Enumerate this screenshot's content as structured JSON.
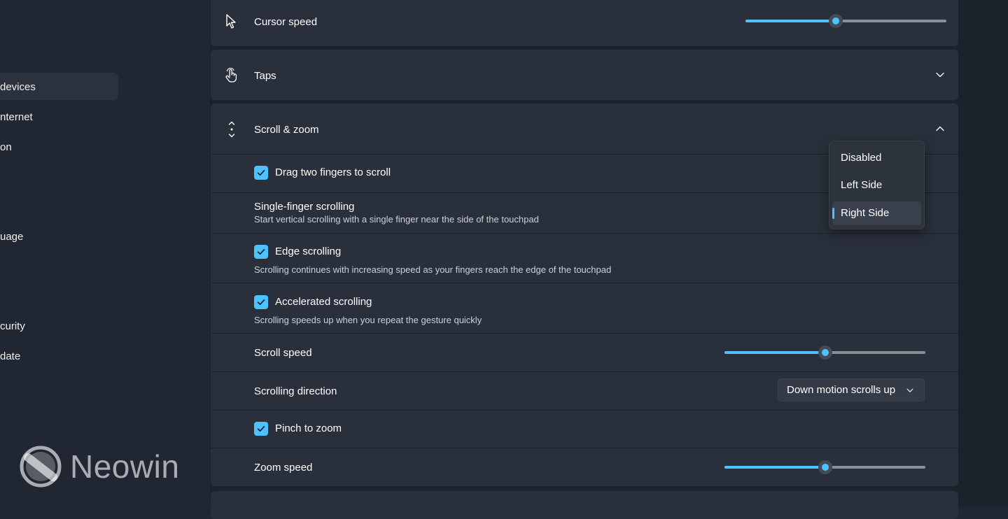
{
  "sidebar": {
    "items": [
      {
        "label": " devices"
      },
      {
        "label": "nternet"
      },
      {
        "label": "on"
      },
      {
        "label": "uage"
      },
      {
        "label": "curity"
      },
      {
        "label": "date"
      }
    ],
    "watermark": "Neowin"
  },
  "cursor_speed": {
    "label": "Cursor speed",
    "value": 0.45
  },
  "taps": {
    "label": "Taps"
  },
  "scroll_zoom": {
    "label": "Scroll & zoom",
    "drag_two_fingers": {
      "label": "Drag two fingers to scroll",
      "checked": true
    },
    "single_finger": {
      "label": "Single-finger scrolling",
      "description": "Start vertical scrolling with a single finger near the side of the touchpad",
      "options": [
        "Disabled",
        "Left Side",
        "Right Side"
      ],
      "selected": "Right Side"
    },
    "edge_scrolling": {
      "label": "Edge scrolling",
      "description": "Scrolling continues with increasing speed as your fingers reach the edge of the touchpad",
      "checked": true
    },
    "accelerated_scrolling": {
      "label": "Accelerated scrolling",
      "description": "Scrolling speeds up when you repeat the gesture quickly",
      "checked": true
    },
    "scroll_speed": {
      "label": "Scroll speed",
      "value": 0.5
    },
    "scrolling_direction": {
      "label": "Scrolling direction",
      "value": "Down motion scrolls up"
    },
    "pinch_to_zoom": {
      "label": "Pinch to zoom",
      "checked": true
    },
    "zoom_speed": {
      "label": "Zoom speed",
      "value": 0.5
    }
  },
  "colors": {
    "accent": "#4cc2ff",
    "background": "#1c222c",
    "card": "#2a303b"
  }
}
